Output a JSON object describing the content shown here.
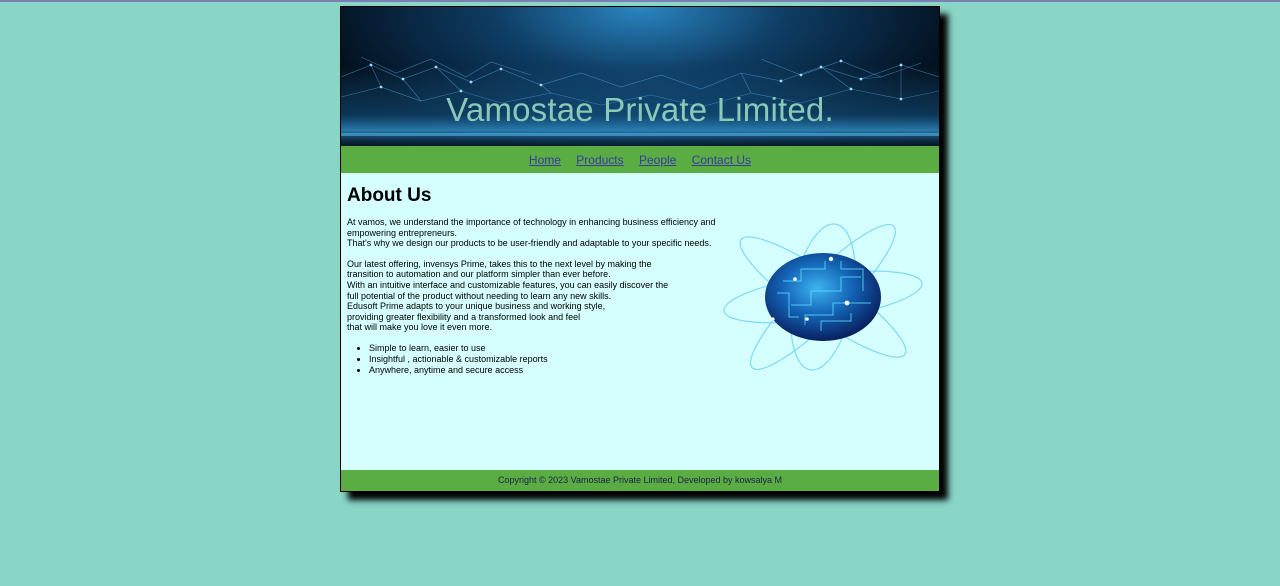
{
  "banner": {
    "title": "Vamostae Private Limited."
  },
  "nav": {
    "items": [
      "Home",
      "Products",
      "People",
      "Contact Us"
    ]
  },
  "main": {
    "heading": "About Us",
    "para1": [
      "At vamos, we understand the importance of technology in enhancing business efficiency and",
      "empowering entrepreneurs.",
      "That's why we design our products to be user-friendly and adaptable to your specific needs."
    ],
    "para2": [
      "Our latest offering, invensys Prime, takes this to the next level by making the",
      "transition to automation and our platform simpler than ever before.",
      "With an intuitive interface and customizable features, you can easily discover the",
      "full potential of the product without needing to learn any new skills.",
      "Edusoft Prime adapts to your unique business and working style,",
      "providing greater flexibility and a transformed look and feel",
      "that will make you love it even more."
    ],
    "bullets": [
      "Simple to learn, easier to use",
      "Insightful , actionable & customizable reports",
      "Anywhere, anytime and secure access"
    ]
  },
  "footer": {
    "text": "Copyright © 2023 Vamostae Private Limited, Developed by kowsalya M"
  },
  "colors": {
    "background": "#89d5c6",
    "nav_bar": "#5aad43",
    "content_bg": "#d5fffe",
    "link": "#3a3aa0",
    "banner_title": "#8ac9b8"
  }
}
